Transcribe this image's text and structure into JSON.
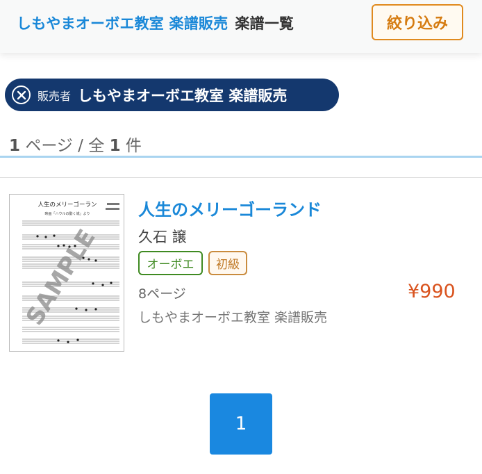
{
  "header": {
    "breadcrumb_link": "しもやまオーボエ教室 楽譜販売",
    "breadcrumb_current": "楽譜一覧",
    "filter_button": "絞り込み"
  },
  "filter_chip": {
    "label": "販売者",
    "value": "しもやまオーボエ教室 楽譜販売"
  },
  "results": {
    "page_num": "1",
    "page_word": "ページ / 全",
    "total": "1",
    "total_suffix": "件"
  },
  "items": [
    {
      "title": "人生のメリーゴーランド",
      "composer": "久石 譲",
      "instrument_tag": "オーボエ",
      "level_tag": "初級",
      "pages": "8ページ",
      "price": "¥990",
      "seller": "しもやまオーボエ教室 楽譜販売",
      "thumbnail": {
        "score_title": "人生のメリーゴーラン",
        "score_subtitle": "映画「ハウルの動く城」より",
        "watermark": "SAMPLE"
      }
    }
  ],
  "pagination": {
    "current": "1"
  },
  "colors": {
    "link_blue": "#1a88d8",
    "chip_navy": "#14386e",
    "filter_orange": "#e08a1e",
    "price_red": "#d9531e",
    "tag_green": "#3f8a22",
    "tag_brown": "#c98b3d",
    "pager_blue": "#1a88e0"
  }
}
